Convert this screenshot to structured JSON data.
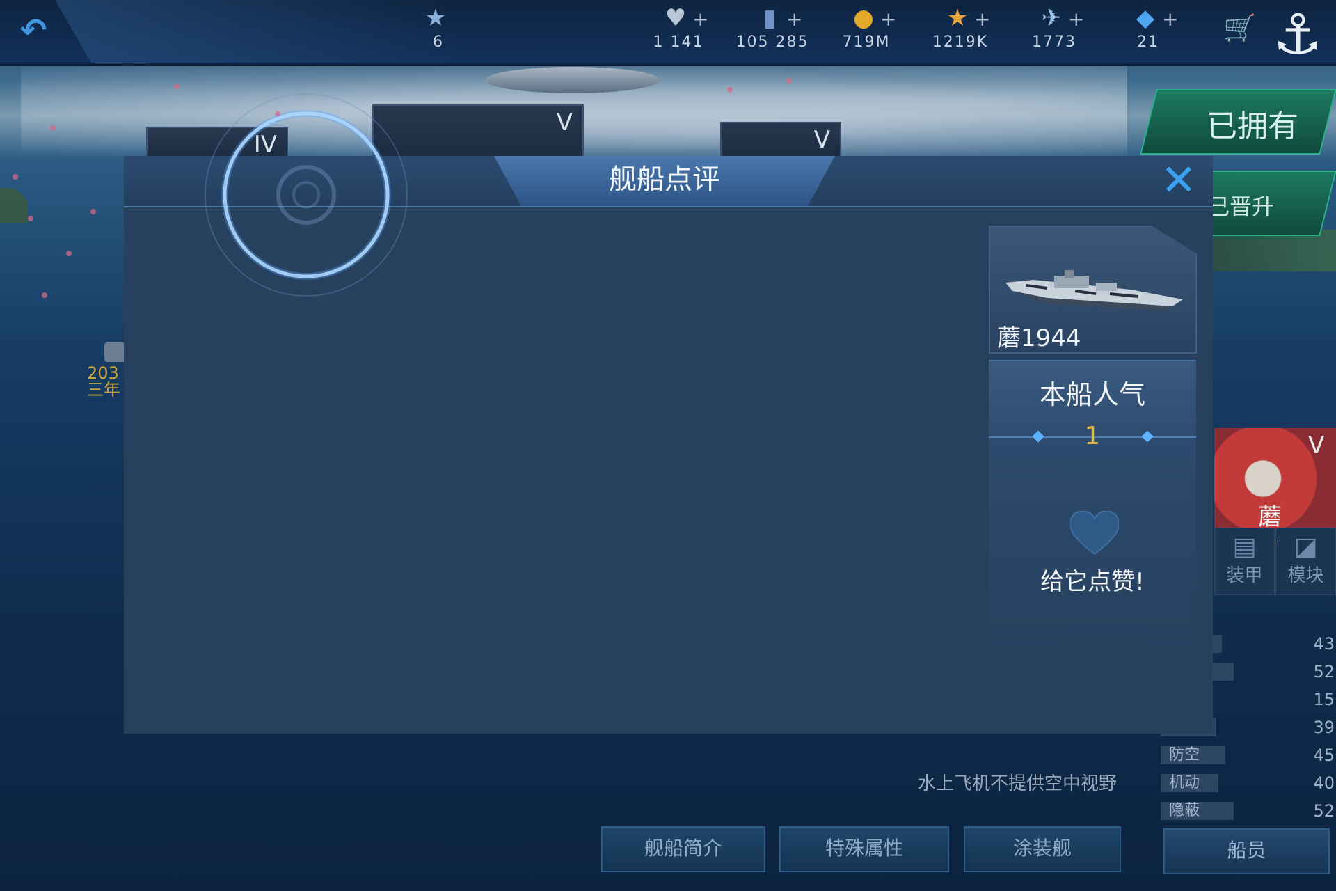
{
  "topbar": {
    "back_icon": "back-arrow-icon",
    "rank_value": "6",
    "resources": [
      {
        "name": "hearts",
        "icon": "heart-icon",
        "value": "1 141"
      },
      {
        "name": "cards",
        "icon": "card-icon",
        "value": "105 285"
      },
      {
        "name": "coins",
        "icon": "gold-coin-icon",
        "value": "719M"
      },
      {
        "name": "stars",
        "icon": "star-icon",
        "value": "1219K"
      },
      {
        "name": "planes",
        "icon": "plane-icon",
        "value": "1773"
      },
      {
        "name": "gems",
        "icon": "gem-icon",
        "value": "21"
      }
    ],
    "plus": "+"
  },
  "background": {
    "card_tiers": [
      "IV",
      "V",
      "V"
    ],
    "left_label_line1": "203",
    "left_label_line2": "三年"
  },
  "right_panel": {
    "owned_label": "已拥有",
    "promoted_label": "己晋升",
    "thumb_tier": "V",
    "thumb_name": "蘑1944",
    "tabs": [
      {
        "label": "装甲",
        "icon": "armor-icon"
      },
      {
        "label": "模块",
        "icon": "module-icon"
      }
    ],
    "stats": [
      {
        "label": "",
        "value": "43",
        "fill": 0.35
      },
      {
        "label": "",
        "value": "52",
        "fill": 0.42
      },
      {
        "label": "",
        "value": "15",
        "fill": 0.12
      },
      {
        "label": "",
        "value": "39",
        "fill": 0.32
      },
      {
        "label": "防空",
        "value": "45",
        "fill": 0.37
      },
      {
        "label": "机动",
        "value": "40",
        "fill": 0.33
      },
      {
        "label": "隐蔽",
        "value": "52",
        "fill": 0.42
      }
    ],
    "crew_button": "船员"
  },
  "note": "水上飞机不提供空中视野",
  "bottom_buttons": [
    "舰船简介",
    "特殊属性",
    "涂装舰"
  ],
  "modal": {
    "title": "舰船点评",
    "close_icon": "close-icon",
    "ship_name": "蘑1944",
    "popularity_title": "本船人气",
    "popularity_count": "1",
    "like_icon": "heart-icon",
    "like_label": "给它点赞!"
  },
  "colors": {
    "accent_blue": "#3aa2f0",
    "gold": "#e6b640",
    "modal_bg": "#27405e",
    "owned_green": "#1d7a60"
  }
}
